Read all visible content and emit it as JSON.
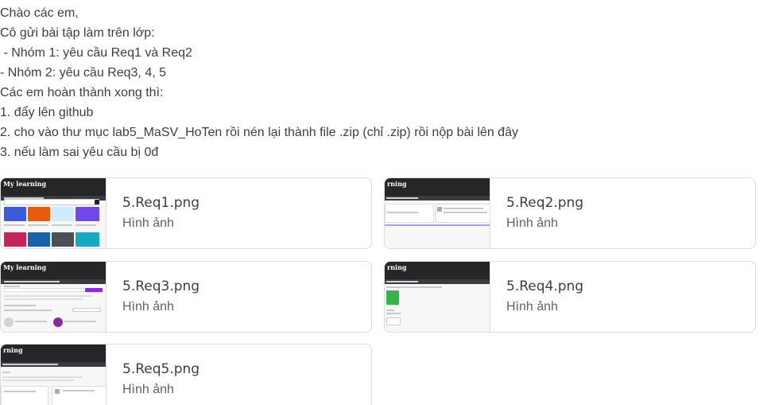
{
  "message": {
    "lines": [
      "Chào các em,",
      "Cô gửi bài tập làm trên lớp:",
      " - Nhóm 1: yêu cầu Req1 và Req2",
      "- Nhóm 2: yêu cầu Req3, 4, 5",
      "Các em hoàn thành xong thì:",
      "1. đẩy lên github",
      "2. cho vào thư mục lab5_MaSV_HoTen rồi nén lại thành file .zip (chỉ .zip) rồi nộp bài lên đây",
      "3. nếu làm sai yêu cầu bị 0đ"
    ]
  },
  "attachments": [
    {
      "name": "5.Req1.png",
      "type": "Hình ảnh",
      "thumb_logo": "My learning"
    },
    {
      "name": "5.Req2.png",
      "type": "Hình ảnh",
      "thumb_logo": "rning"
    },
    {
      "name": "5.Req3.png",
      "type": "Hình ảnh",
      "thumb_logo": "My learning"
    },
    {
      "name": "5.Req4.png",
      "type": "Hình ảnh",
      "thumb_logo": "rning"
    },
    {
      "name": "5.Req5.png",
      "type": "Hình ảnh",
      "thumb_logo": "rning"
    }
  ],
  "colors": {
    "border": "#dadce0",
    "text": "#3c4043",
    "muted": "#5f6368",
    "thumb_header": "#252628",
    "accent": "#8a2be2"
  }
}
